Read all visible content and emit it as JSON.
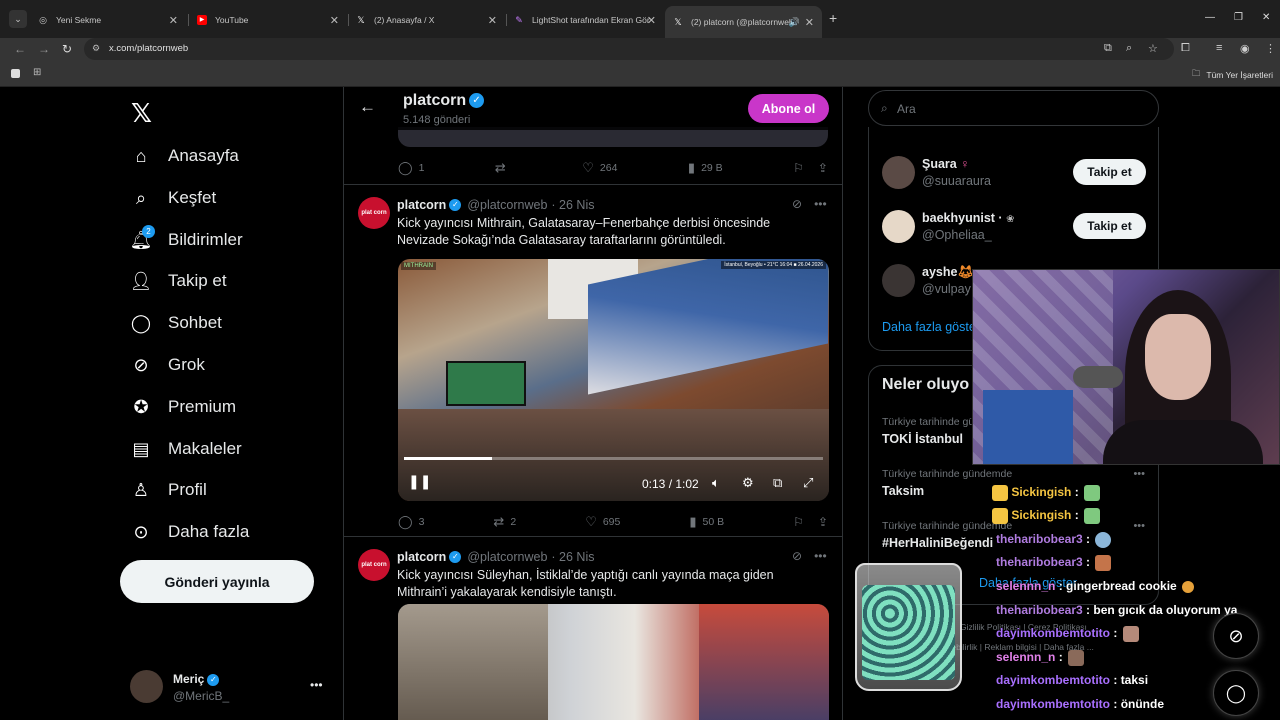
{
  "browser": {
    "tabs": [
      {
        "title": "Yeni Sekme",
        "icon": "chrome-icon"
      },
      {
        "title": "YouTube",
        "icon": "youtube-icon"
      },
      {
        "title": "(2) Anasayfa / X",
        "icon": "x-icon"
      },
      {
        "title": "LightShot tarafından Ekran Gör",
        "icon": "lightshot-icon"
      },
      {
        "title": "(2) platcorn (@platcornweb",
        "icon": "x-icon"
      }
    ],
    "url": "x.com/platcornweb",
    "bookmarks_all": "Tüm Yer İşaretleri"
  },
  "sidebar": {
    "items": [
      {
        "label": "Anasayfa",
        "icon": "home-icon"
      },
      {
        "label": "Keşfet",
        "icon": "search-icon"
      },
      {
        "label": "Bildirimler",
        "icon": "bell-icon",
        "badge": "2"
      },
      {
        "label": "Takip et",
        "icon": "add-user-icon"
      },
      {
        "label": "Sohbet",
        "icon": "chat-icon"
      },
      {
        "label": "Grok",
        "icon": "grok-icon"
      },
      {
        "label": "Premium",
        "icon": "premium-icon"
      },
      {
        "label": "Makaleler",
        "icon": "article-icon"
      },
      {
        "label": "Profil",
        "icon": "profile-icon"
      },
      {
        "label": "Daha fazla",
        "icon": "more-icon"
      }
    ],
    "post_button": "Gönderi yayınla",
    "account": {
      "name": "Meriç",
      "handle": "@MericB_"
    }
  },
  "profile_header": {
    "name": "platcorn",
    "post_count": "5.148 gönderi",
    "subscribe_label": "Abone ol"
  },
  "tweets": [
    {
      "replies": "1",
      "retweets": "",
      "likes": "264",
      "views": "29 B"
    },
    {
      "author": "platcorn",
      "handle": "@platcornweb",
      "date": "· 26 Nis",
      "avatar_text": "plat corn",
      "text": "Kick yayıncısı Mithrain, Galatasaray–Fenerbahçe derbisi öncesinde Nevizade Sokağı’nda Galatasaray taraftarlarını görüntüledi.",
      "video": {
        "overlay_left": "MITHRAIN",
        "overlay_right": "İstanbul, Beyoğlu • 21°C 16:04 ■ 26.04.2026",
        "time": "0:13 / 1:02",
        "progress": 0.21
      },
      "replies": "3",
      "retweets": "2",
      "likes": "695",
      "views": "50 B"
    },
    {
      "author": "platcorn",
      "handle": "@platcornweb",
      "date": "· 26 Nis",
      "avatar_text": "plat corn",
      "text": "Kick yayıncısı Süleyhan, İstiklal’de yaptığı canlı yayında maça giden Mithrain’i yakalayarak kendisiyle tanıştı."
    }
  ],
  "right": {
    "search_placeholder": "Ara",
    "follow_suggestions": [
      {
        "name": "Şuara",
        "handle": "@suuaraura",
        "button": "Takip et"
      },
      {
        "name": "baekhyunist ·",
        "handle": "@Opheliaa_",
        "button": "Takip et"
      },
      {
        "name": "ayshe",
        "handle": "@vulpay"
      }
    ],
    "show_more": "Daha fazla göster",
    "trends_title": "Neler oluyo",
    "trends": [
      {
        "meta": "Türkiye tarihinde gündemde",
        "name": "TOKİ İstanbul"
      },
      {
        "meta": "Türkiye tarihinde gündemde",
        "name": "Taksim"
      },
      {
        "meta": "Türkiye tarihinde gündemde",
        "name": "#HerHaliniBeğendi"
      }
    ],
    "trends_more": "Daha fazla göster",
    "footer": [
      "Gizlilik Politikası",
      "Çerez Politikası",
      "Erişilebilirlik",
      "Reklam bilgisi",
      "Daha fazla ..."
    ]
  },
  "stream_chat": [
    {
      "user": "Sickingish",
      "text": "",
      "color": "#f5c542"
    },
    {
      "user": "Sickingish",
      "text": "",
      "color": "#f5c542"
    },
    {
      "user": "theharibobear3",
      "text": "",
      "color": "#b07ce0"
    },
    {
      "user": "theharibobear3",
      "text": "",
      "color": "#b07ce0"
    },
    {
      "user": "selennn_n",
      "text": "gingerbread cookie",
      "color": "#e080e8"
    },
    {
      "user": "theharibobear3",
      "text": "ben gıcık da oluyorum ya",
      "color": "#b07ce0"
    },
    {
      "user": "dayimkombemtotito",
      "text": "",
      "color": "#a970ff"
    },
    {
      "user": "selennn_n",
      "text": "",
      "color": "#e080e8"
    },
    {
      "user": "dayimkombemtotito",
      "text": "taksi",
      "color": "#a970ff"
    },
    {
      "user": "dayimkombemtotito",
      "text": "önünde",
      "color": "#a970ff"
    }
  ]
}
